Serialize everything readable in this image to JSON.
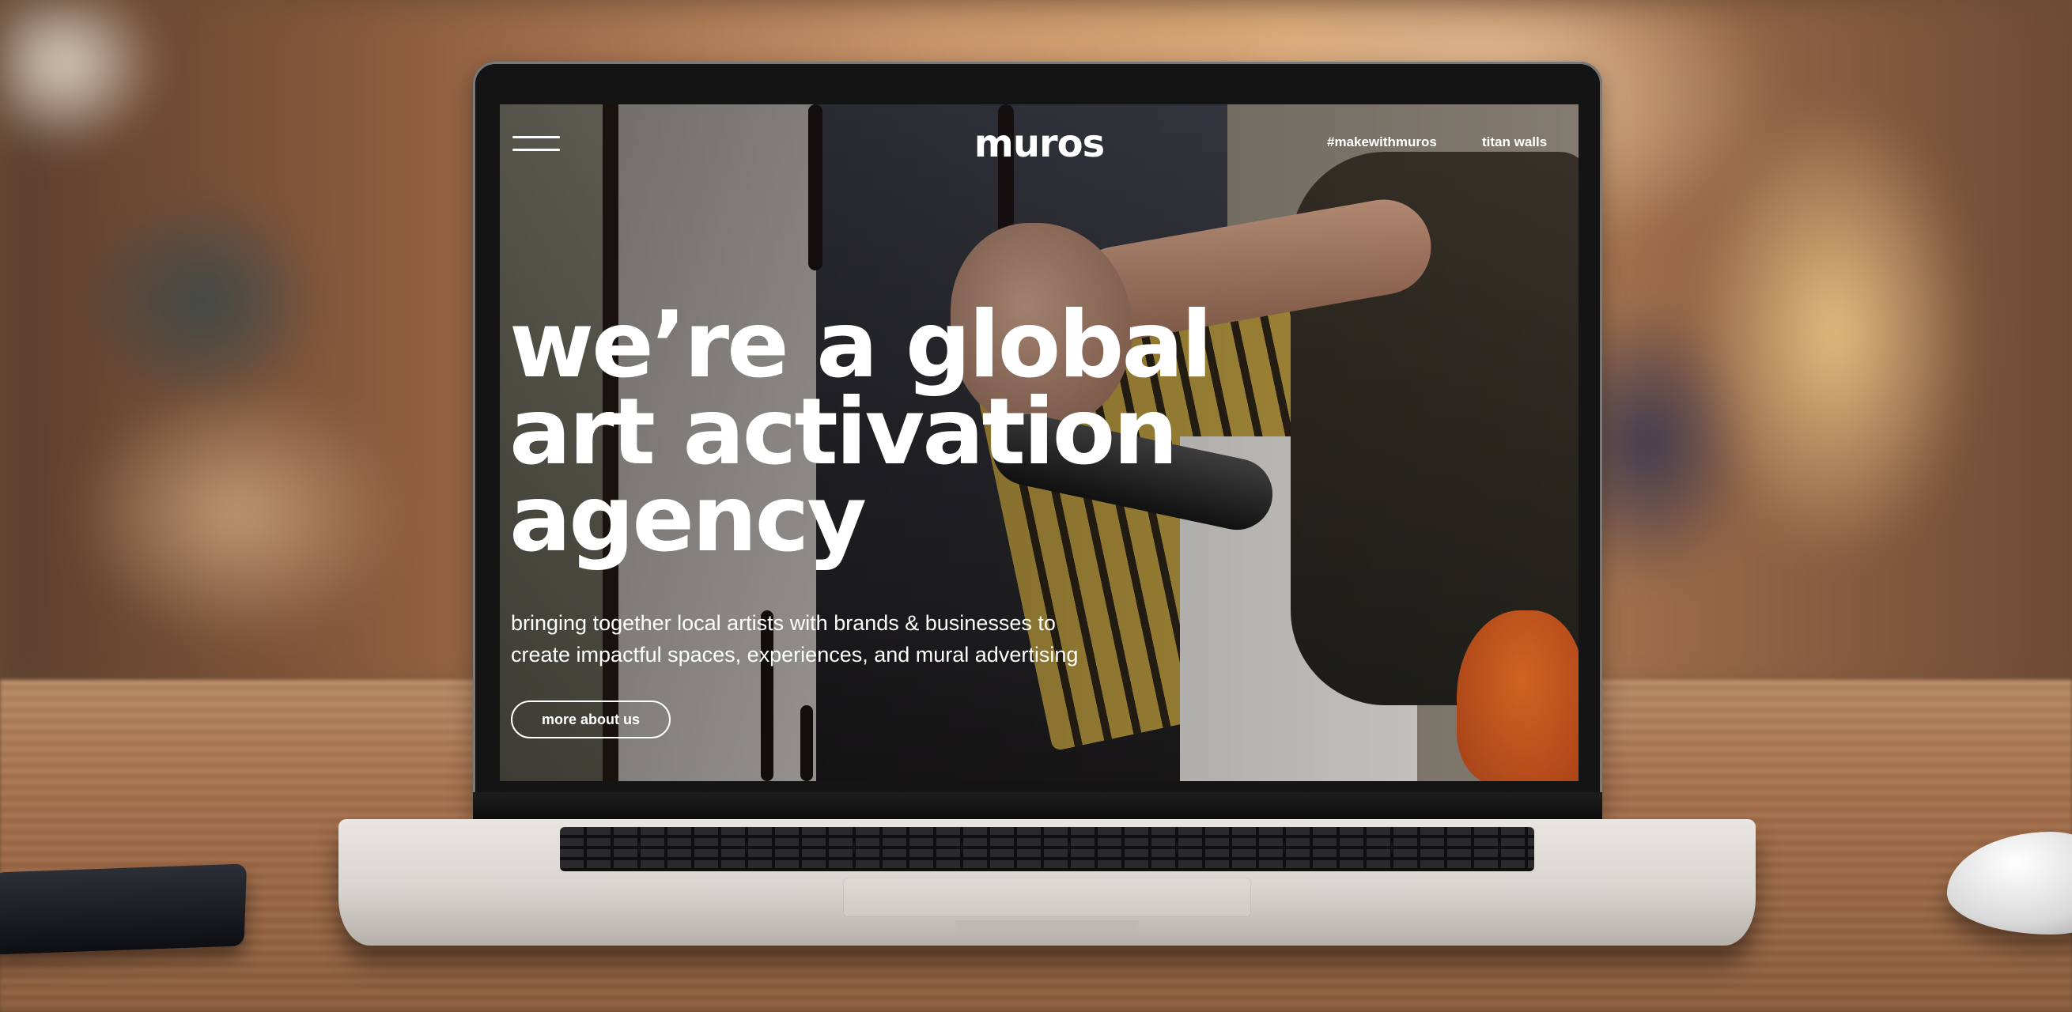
{
  "site": {
    "logo": "muros",
    "nav": {
      "hashtag": "#makewithmuros",
      "titan": "titan walls"
    }
  },
  "hero": {
    "title_lines": [
      "we’re a global",
      "art activation",
      "agency"
    ],
    "subtitle_lines": [
      "bringing together local artists with brands & businesses to",
      "create impactful spaces, experiences, and mural advertising"
    ],
    "cta_label": "more about us"
  }
}
